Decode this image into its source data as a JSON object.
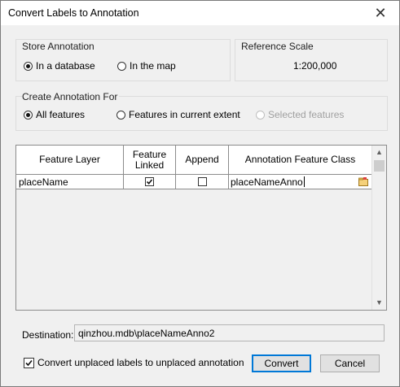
{
  "window": {
    "title": "Convert Labels to Annotation",
    "close": "✕"
  },
  "store": {
    "label": "Store Annotation",
    "options": [
      "In a database",
      "In the map"
    ],
    "selected_index": 0
  },
  "reference_scale": {
    "label": "Reference Scale",
    "value": "1:200,000"
  },
  "create_for": {
    "label": "Create Annotation For",
    "options": [
      "All features",
      "Features in current extent",
      "Selected features"
    ],
    "selected_index": 0,
    "disabled": [
      "Selected features"
    ]
  },
  "table": {
    "headers": {
      "feature_layer": "Feature Layer",
      "feature_linked_1": "Feature",
      "feature_linked_2": "Linked",
      "append": "Append",
      "annotation_class": "Annotation Feature Class"
    },
    "rows": [
      {
        "feature_layer": "placeName",
        "feature_linked": true,
        "append": false,
        "annotation_class": "placeNameAnno"
      }
    ]
  },
  "destination": {
    "label": "Destination:",
    "value": "qinzhou.mdb\\placeNameAnno2"
  },
  "convert_unplaced": {
    "label": "Convert unplaced labels to unplaced annotation",
    "checked": true
  },
  "buttons": {
    "convert": "Convert",
    "cancel": "Cancel"
  },
  "icons": {
    "check": "✓",
    "scroll_up": "▲",
    "scroll_down": "▼",
    "browse": "browse-folder-icon"
  }
}
